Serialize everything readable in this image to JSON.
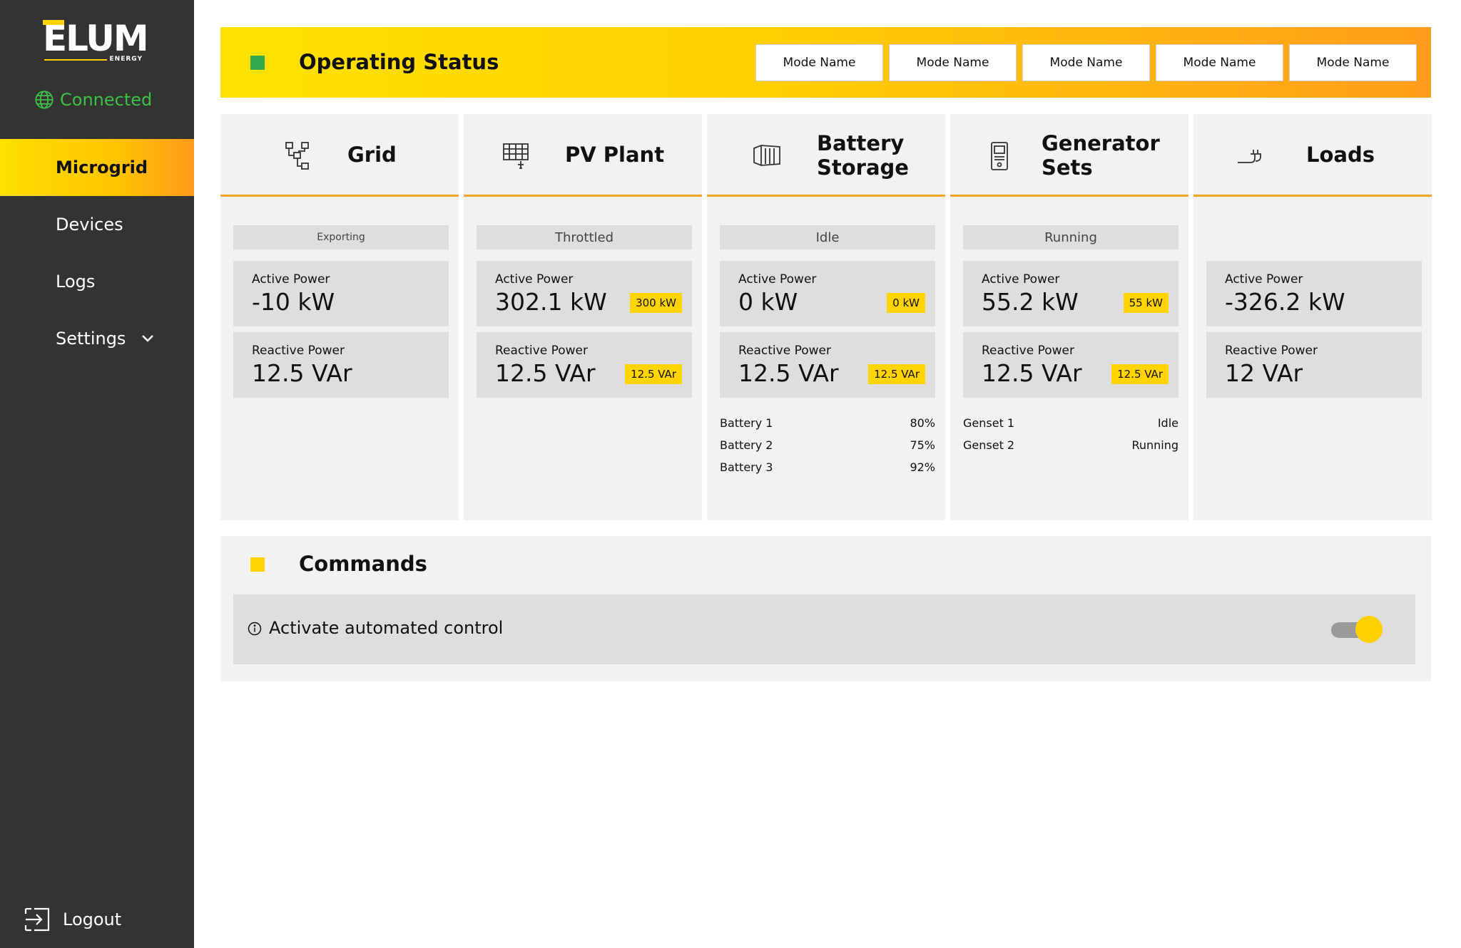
{
  "brand": {
    "name": "ELUM",
    "sub": "ENERGY",
    "connection": "Connected"
  },
  "nav": {
    "items": [
      {
        "label": "Microgrid"
      },
      {
        "label": "Devices"
      },
      {
        "label": "Logs"
      },
      {
        "label": "Settings"
      }
    ],
    "logout": "Logout"
  },
  "status": {
    "title": "Operating Status",
    "modes": [
      "Mode Name",
      "Mode Name",
      "Mode Name",
      "Mode Name",
      "Mode Name"
    ]
  },
  "cards": {
    "grid": {
      "title": "Grid",
      "state": "Exporting",
      "active_label": "Active Power",
      "active_value": "-10 kW",
      "reactive_label": "Reactive Power",
      "reactive_value": "12.5 VAr"
    },
    "pv": {
      "title": "PV Plant",
      "state": "Throttled",
      "active_label": "Active Power",
      "active_value": "302.1 kW",
      "active_tag": "300 kW",
      "reactive_label": "Reactive Power",
      "reactive_value": "12.5 VAr",
      "reactive_tag": "12.5 VAr"
    },
    "battery": {
      "title_line1": "Battery",
      "title_line2": "Storage",
      "state": "Idle",
      "active_label": "Active Power",
      "active_value": "0 kW",
      "active_tag": "0 kW",
      "reactive_label": "Reactive Power",
      "reactive_value": "12.5 VAr",
      "reactive_tag": "12.5 VAr",
      "units": [
        {
          "name": "Battery 1",
          "value": "80%"
        },
        {
          "name": "Battery 2",
          "value": "75%"
        },
        {
          "name": "Battery 3",
          "value": "92%"
        }
      ]
    },
    "generator": {
      "title_line1": "Generator",
      "title_line2": "Sets",
      "state": "Running",
      "active_label": "Active Power",
      "active_value": "55.2 kW",
      "active_tag": "55 kW",
      "reactive_label": "Reactive Power",
      "reactive_value": "12.5 VAr",
      "reactive_tag": "12.5 VAr",
      "units": [
        {
          "name": "Genset 1",
          "value": "Idle"
        },
        {
          "name": "Genset 2",
          "value": "Running"
        }
      ]
    },
    "loads": {
      "title": "Loads",
      "active_label": "Active Power",
      "active_value": "-326.2 kW",
      "reactive_label": "Reactive Power",
      "reactive_value": "12 VAr"
    }
  },
  "commands": {
    "title": "Commands",
    "auto_control_label": "Activate automated control",
    "auto_control_on": true
  },
  "colors": {
    "accent_yellow": "#ffd400",
    "accent_orange": "#f6a22b",
    "status_green": "#32a852",
    "connected_green": "#3fbf4a",
    "sidebar_bg": "#333332"
  }
}
